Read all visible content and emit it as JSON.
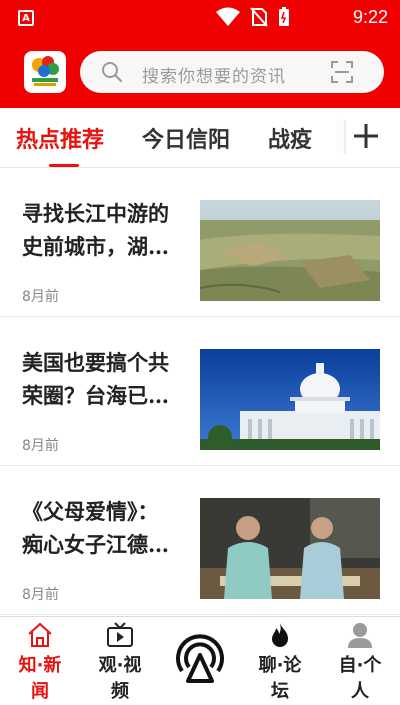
{
  "status": {
    "time": "9:22"
  },
  "search": {
    "placeholder": "搜索你想要的资讯"
  },
  "tabs": [
    {
      "label": "热点推荐",
      "active": true
    },
    {
      "label": "今日信阳",
      "active": false
    },
    {
      "label": "战疫",
      "active": false
    }
  ],
  "news": [
    {
      "title_line1": "寻找长江中游的",
      "title_line2": "史前城市，湖…",
      "time": "8月前",
      "thumb": "aerial-landscape"
    },
    {
      "title_line1": "美国也要搞个共",
      "title_line2": "荣圈？台海已…",
      "time": "8月前",
      "thumb": "capitol-building"
    },
    {
      "title_line1": "《父母爱情》：",
      "title_line2": "痴心女子江德…",
      "time": "8月前",
      "thumb": "drama-still"
    }
  ],
  "bottom_nav": [
    {
      "label_line1": "知·新",
      "label_line2": "闻",
      "icon": "home-icon",
      "active": true
    },
    {
      "label_line1": "观·视",
      "label_line2": "频",
      "icon": "video-icon",
      "active": false
    },
    {
      "label_line1": "聊·论",
      "label_line2": "坛",
      "icon": "flame-icon",
      "active": false
    },
    {
      "label_line1": "自·个",
      "label_line2": "人",
      "icon": "person-icon",
      "active": false
    }
  ],
  "colors": {
    "brand_red": "#f00000",
    "active_red": "#e8130f"
  }
}
